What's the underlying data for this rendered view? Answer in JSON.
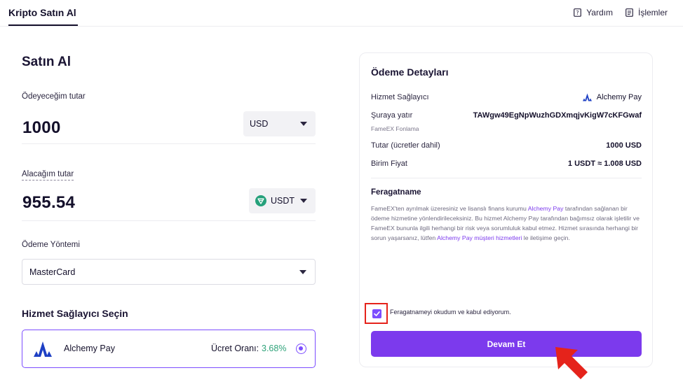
{
  "topbar": {
    "active_tab": "Kripto Satın Al",
    "help_label": "Yardım",
    "transactions_label": "İşlemler"
  },
  "buy": {
    "title": "Satın Al",
    "pay_label": "Ödeyeceğim tutar",
    "pay_amount": "1000",
    "pay_currency": "USD",
    "receive_label": "Alacağım tutar",
    "receive_amount": "955.54",
    "receive_currency": "USDT",
    "method_label": "Ödeme Yöntemi",
    "method_value": "MasterCard"
  },
  "provider": {
    "title": "Hizmet Sağlayıcı Seçin",
    "name": "Alchemy Pay",
    "fee_label": "Ücret Oranı:",
    "fee_value": "3.68%"
  },
  "details": {
    "title": "Ödeme Detayları",
    "provider_key": "Hizmet Sağlayıcı",
    "provider_value": "Alchemy Pay",
    "deposit_key": "Şuraya yatır",
    "deposit_value": "TAWgw49EgNpWuzhGDXmqjvKigW7cKFGwaf",
    "deposit_sub": "FameEX Fonlama",
    "amount_key": "Tutar (ücretler dahil)",
    "amount_value": "1000 USD",
    "unit_key": "Birim Fiyat",
    "unit_value": "1 USDT ≈ 1.008 USD",
    "disclaimer_title": "Feragatname",
    "disclaimer_p1": "FameEX'ten ayrılmak üzeresiniz ve lisanslı finans kurumu ",
    "disclaimer_link1": "Alchemy Pay",
    "disclaimer_p2": " tarafından sağlanan bir ödeme hizmetine yönlendirileceksiniz. Bu hizmet Alchemy Pay tarafından bağımsız olarak işletilir ve FameEX bununla ilgili herhangi bir risk veya sorumluluk kabul etmez. Hizmet sırasında herhangi bir sorun yaşarsanız, lütfen ",
    "disclaimer_link2": "Alchemy Pay müşteri hizmetleri",
    "disclaimer_p3": " le iletişime geçin.",
    "checkbox_label": "Feragatnameyi okudum ve kabul ediyorum.",
    "checkbox_checked": true,
    "continue_label": "Devam Et"
  },
  "colors": {
    "accent": "#7c3aed",
    "fee_green": "#2fa37a",
    "highlight_red": "#e5231b",
    "tether_green": "#26a17b"
  }
}
